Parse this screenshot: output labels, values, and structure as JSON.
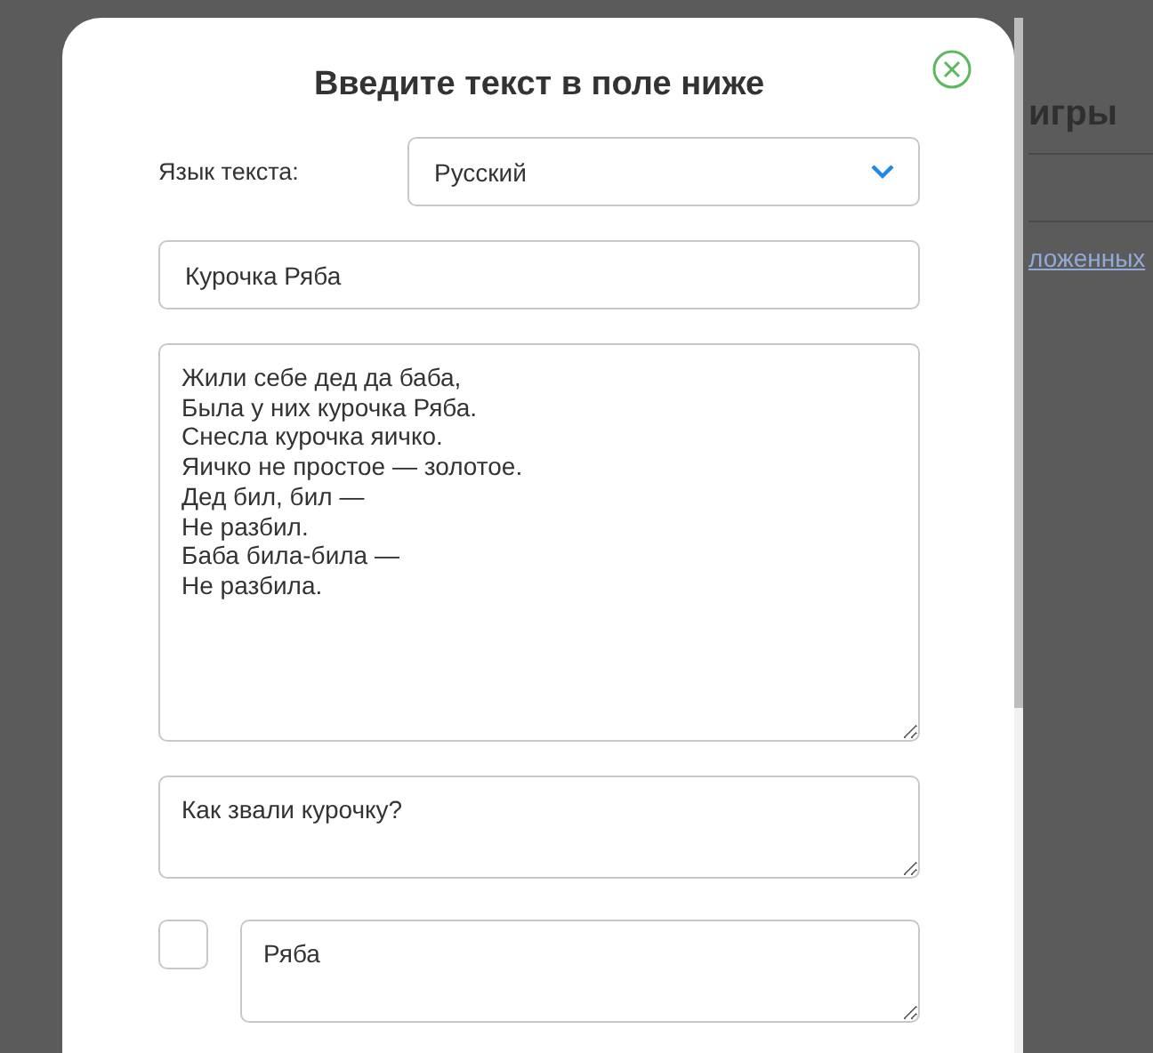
{
  "background": {
    "heading": "игры",
    "link": "ложенных"
  },
  "dialog": {
    "title": "Введите текст в поле ниже",
    "language": {
      "label": "Язык текста:",
      "value": "Русский"
    },
    "title_field": {
      "value": "Курочка Ряба"
    },
    "text_field": {
      "value": "Жили себе дед да баба,\nБыла у них курочка Ряба.\nСнесла курочка яичко.\nЯичко не простое — золотое.\nДед бил, бил —\nНе разбил.\nБаба била-била —\nНе разбила."
    },
    "question_field": {
      "value": "Как звали курочку?"
    },
    "answers": [
      {
        "checked": false,
        "value": "Ряба"
      }
    ]
  }
}
